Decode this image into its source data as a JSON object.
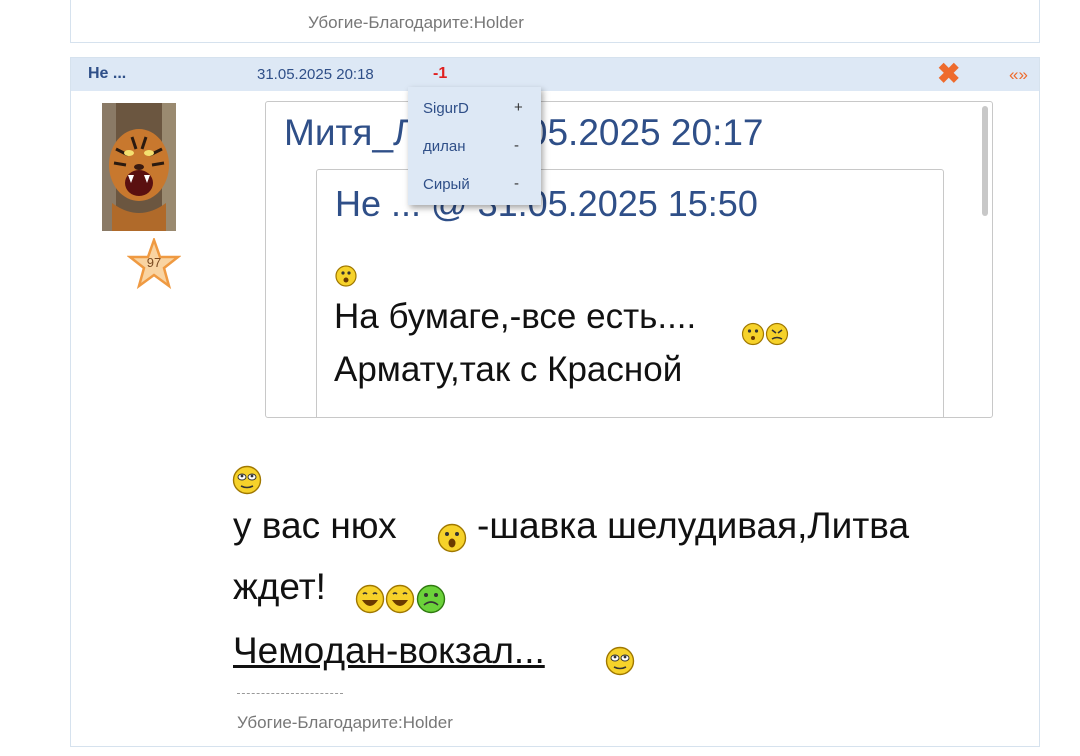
{
  "prev_post": {
    "signature": "Убогие-Благодарите:Holder"
  },
  "post": {
    "author": "Не ...",
    "date": "31.05.2025 20:18",
    "rating": "-1",
    "close_icon": "close-x-icon",
    "quote_link": "«»",
    "avatar": {
      "icon": "tiger-avatar"
    },
    "reputation": "97",
    "quote": {
      "title": "Митя_Л @ 31.05.2025 20:17",
      "nested": {
        "title": "Не ... @ 31.05.2025 15:50",
        "line1": "На бумаге,-все есть....",
        "line2": "Армату,так с Красной"
      }
    },
    "body": {
      "line1a": "у вас нюх",
      "line1b": "-шавка шелудивая,Литва",
      "line2": "ждет!",
      "link": "Чемодан-вокзал..."
    },
    "separator": "--------------------",
    "signature": "Убогие-Благодарите:Holder"
  },
  "rating_popup": {
    "voters": [
      {
        "name": "SigurD",
        "sign": "+"
      },
      {
        "name": "дилан",
        "sign": "-"
      },
      {
        "name": "Сирый",
        "sign": "-"
      }
    ]
  },
  "colors": {
    "header_bg": "#dde8f5",
    "author": "#2f4f88",
    "rating": "#e02020",
    "accent": "#ee6b2d"
  }
}
